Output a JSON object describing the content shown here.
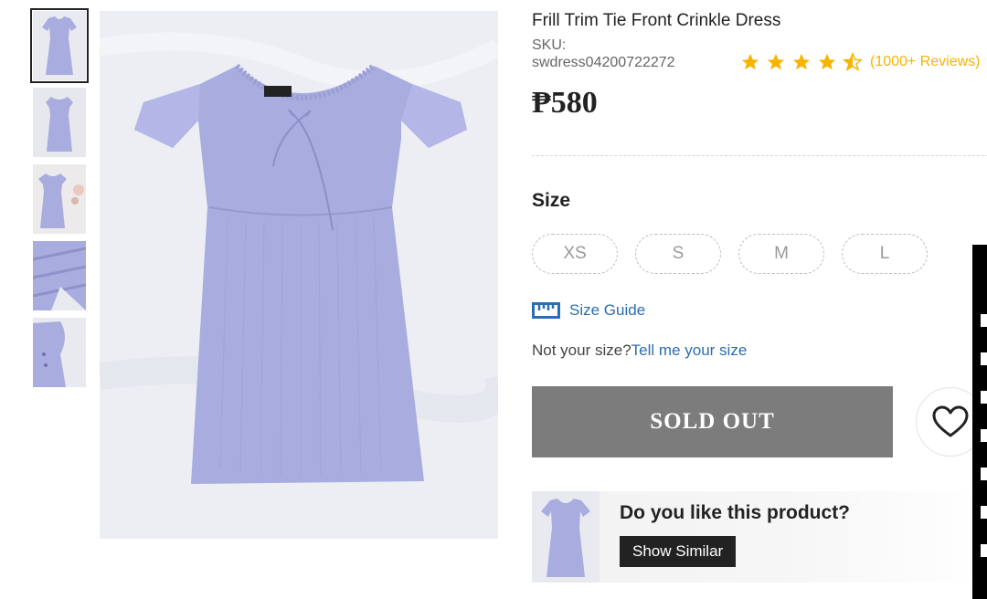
{
  "product": {
    "title": "Frill Trim Tie Front Crinkle Dress",
    "sku_label": "SKU:",
    "sku_value": "swdress04200722272",
    "rating": 4.5,
    "reviews_text": "(1000+ Reviews)",
    "price": "₱580",
    "dress_color": "#a9acdf"
  },
  "size": {
    "label": "Size",
    "options": [
      "XS",
      "S",
      "M",
      "L"
    ]
  },
  "size_guide": {
    "icon": "ruler-icon",
    "label": "Size Guide"
  },
  "not_your_size": {
    "prompt": "Not your size?",
    "link": "Tell me your size"
  },
  "actions": {
    "sold_out_label": "SOLD OUT",
    "wishlist_icon": "heart-icon"
  },
  "like_section": {
    "question": "Do you like this product?",
    "button": "Show Similar"
  },
  "gallery": {
    "thumb_count": 5,
    "active_index": 0
  },
  "colors": {
    "star": "#f5b400",
    "link": "#2b6db3",
    "sold_out_bg": "#7c7c7c"
  }
}
